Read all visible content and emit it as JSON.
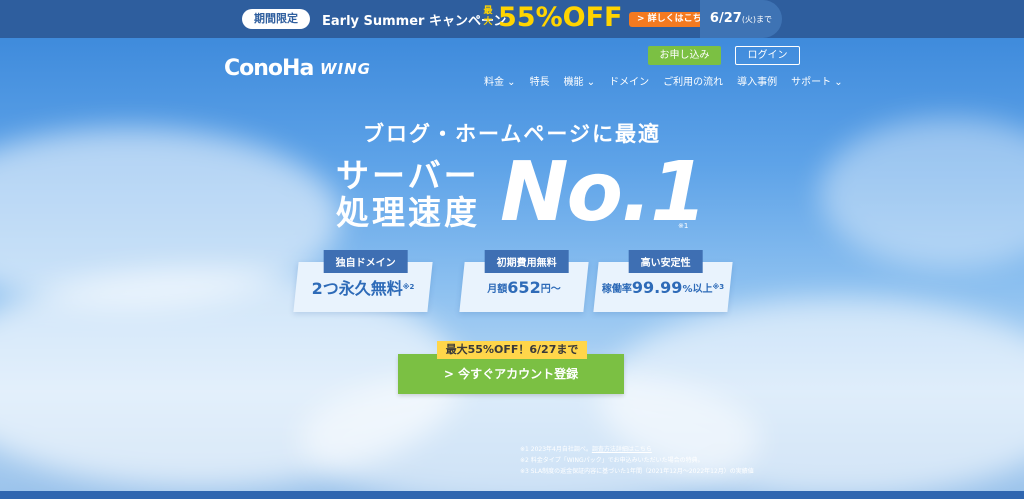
{
  "campaign": {
    "tag": "期間限定",
    "name": "Early Summer キャンペーン",
    "max_label": "最大",
    "discount": "55%OFF",
    "detail_button": "> 詳しくはこちら",
    "date_main": "6/27",
    "date_sub": "(火)まで"
  },
  "header": {
    "logo": "ConoHa",
    "logo_sub": "WING",
    "apply_button": "お申し込み",
    "login_button": "ログイン",
    "nav": [
      "料金 ⌄",
      "特長",
      "機能 ⌄",
      "ドメイン",
      "ご利用の流れ",
      "導入事例",
      "サポート ⌄"
    ]
  },
  "hero": {
    "subhead": "ブログ・ホームページに最適",
    "line1": "サーバー",
    "line2": "処理速度",
    "no1": "No.1",
    "note_mark": "※1"
  },
  "features": [
    {
      "tag": "独自ドメイン",
      "main": "2つ永久無料",
      "note": "※2"
    },
    {
      "tag": "初期費用無料",
      "pre": "月額",
      "main": "652",
      "post": "円〜"
    },
    {
      "tag": "高い安定性",
      "pre": "稼働率",
      "main": "99.99",
      "post": "%以上",
      "note": "※3"
    }
  ],
  "cta": {
    "badge": "最大55%OFF！6/27まで",
    "button": "> 今すぐアカウント登録"
  },
  "notes": {
    "line1_a": "※1 2023年4月自社調べ。",
    "line1_link": "調査方法詳細はこちら",
    "line2": "※2 料金タイプ「WINGパック」でお申込みいただいた場合の特典。",
    "line3": "※3 SLA制度の返金保証内容に基づいた1年間（2021年12月〜2022年12月）の実績値"
  },
  "colors": {
    "accent_green": "#7bc043",
    "campaign_yellow": "#ffd400",
    "topbar_blue": "#2e5e9e",
    "tag_blue": "#3e6fb3"
  }
}
